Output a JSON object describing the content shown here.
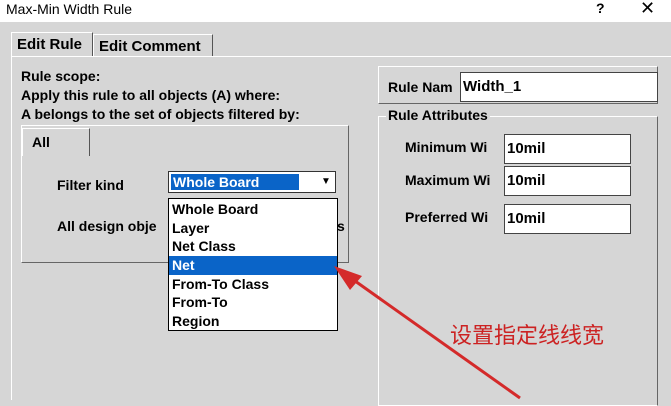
{
  "window": {
    "title": "Max-Min Width Rule",
    "help": "?",
    "close": "✕"
  },
  "tabs": [
    {
      "label": "Edit Rule"
    },
    {
      "label": "Edit Comment"
    }
  ],
  "scope": {
    "line1": "Rule scope:",
    "line2": "Apply this rule to all objects (A) where:",
    "line3": "A belongs to the set of objects filtered by:"
  },
  "filter": {
    "tab_label": "All",
    "filter_kind_label": "Filter kind",
    "selected_value": "Whole Board",
    "all_design_label": "All design obje",
    "options": [
      "Whole Board",
      "Layer",
      "Net Class",
      "Net",
      "From-To Class",
      "From-To",
      "Region"
    ],
    "highlighted_option": "Net"
  },
  "rule_name": {
    "label": "Rule Nam",
    "value": "Width_1"
  },
  "attributes": {
    "title": "Rule Attributes",
    "min_label": "Minimum Wi",
    "min_value": "10mil",
    "max_label": "Maximum Wi",
    "max_value": "10mil",
    "pref_label": "Preferred Wi",
    "pref_value": "10mil"
  },
  "annotation": {
    "text": "设置指定线线宽",
    "color": "#cc2222"
  }
}
